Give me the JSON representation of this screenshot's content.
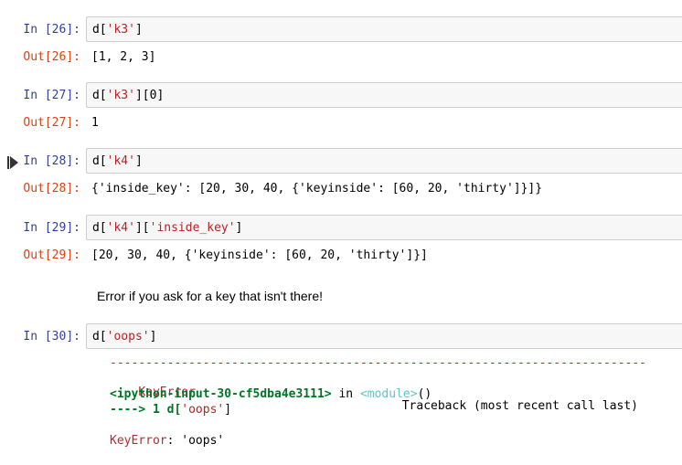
{
  "cells": [
    {
      "in_prompt": "In [26]:",
      "code": {
        "prefix": "d[",
        "str": "'k3'",
        "suffix": "]"
      },
      "out_prompt": "Out[26]:",
      "output": "[1, 2, 3]"
    },
    {
      "in_prompt": "In [27]:",
      "code": {
        "prefix": "d[",
        "str": "'k3'",
        "suffix": "][0]"
      },
      "out_prompt": "Out[27]:",
      "output": "1"
    },
    {
      "in_prompt": "In [28]:",
      "code": {
        "prefix": "d[",
        "str": "'k4'",
        "suffix": "]"
      },
      "out_prompt": "Out[28]:",
      "output": "{'inside_key': [20, 30, 40, {'keyinside': [60, 20, 'thirty']}]}"
    },
    {
      "in_prompt": "In [29]:",
      "code": {
        "prefix": "d[",
        "str": "'k4'",
        "mid": "][",
        "str2": "'inside_key'",
        "suffix": "]"
      },
      "out_prompt": "Out[29]:",
      "output": "[20, 30, 40, {'keyinside': [60, 20, 'thirty']}]"
    }
  ],
  "markdown_text": "Error if you ask for a key that isn't there!",
  "error_cell": {
    "in_prompt": "In [30]:",
    "code": {
      "prefix": "d[",
      "str": "'oops'",
      "suffix": "]"
    },
    "traceback": {
      "dashes": "---------------------------------------------------------------------------",
      "error_name": "KeyError",
      "traceback_header": "Traceback (most recent call last)",
      "input_ref": "<ipython-input-30-cf5dba4e3111>",
      "in_word": " in ",
      "module_ref": "<module>",
      "module_parens": "()",
      "arrow_line_prefix": "----> 1 d[",
      "arrow_line_str": "'oops'",
      "arrow_line_suffix": "]",
      "final_error_name": "KeyError",
      "final_error_msg": ": 'oops'"
    }
  },
  "icons": {
    "run_indicator": "run-step-icon"
  }
}
